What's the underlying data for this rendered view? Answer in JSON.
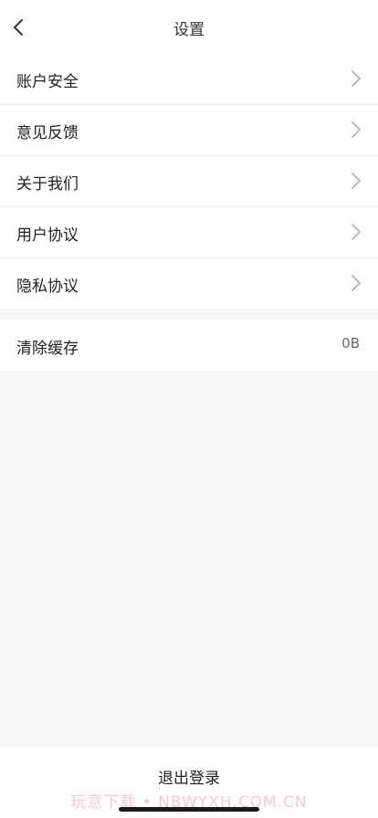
{
  "nav": {
    "title": "设置",
    "back_icon": "chevron-left-icon"
  },
  "settings": {
    "items": [
      {
        "label": "账户安全",
        "icon": "chevron-right-icon"
      },
      {
        "label": "意见反馈",
        "icon": "chevron-right-icon"
      },
      {
        "label": "关于我们",
        "icon": "chevron-right-icon"
      },
      {
        "label": "用户协议",
        "icon": "chevron-right-icon"
      },
      {
        "label": "隐私协议",
        "icon": "chevron-right-icon"
      }
    ],
    "cache": {
      "label": "清除缓存",
      "value": "0B"
    }
  },
  "footer": {
    "logout_label": "退出登录",
    "watermark": "玩意下载 • NBWYXH.COM.CN"
  },
  "colors": {
    "background": "#f6f6f6",
    "surface": "#ffffff",
    "divider": "#ececec",
    "chevron": "#b0b0b0",
    "watermark": "#f7c7d6"
  }
}
